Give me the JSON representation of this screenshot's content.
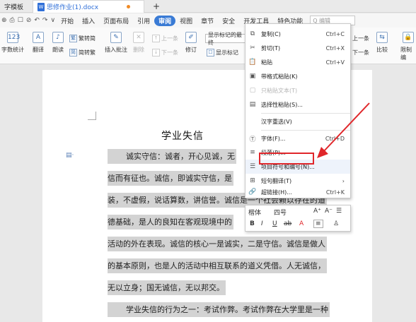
{
  "tabs": {
    "first": "字模板",
    "doc_name": "思修作业(1).docx",
    "new_tab": "+"
  },
  "menubar": {
    "quick_icons": [
      "⊕",
      "⎙",
      "☐",
      "⊘",
      "↶",
      "↷",
      "∨"
    ],
    "items": [
      "开始",
      "插入",
      "页面布局",
      "引用",
      "审阅",
      "视图",
      "章节",
      "安全",
      "开发工具",
      "特色功能"
    ],
    "active_index": 4,
    "search_placeholder": "Q 编辑"
  },
  "ribbon": {
    "word_count": "字数统计",
    "translate": "翻译",
    "read_aloud": "朗读",
    "trad_to_simp": "繁转简",
    "simp_to_trad": "简转繁",
    "insert_comment": "插入批注",
    "delete": "删除",
    "prev": "上一条",
    "next": "下一条",
    "revise": "修订",
    "show_markup_final": "显示标记的最终",
    "show_markup": "显示标记",
    "compare": "比较",
    "restrict": "限制编",
    "prev_right": "上一条",
    "next_right": "下一条"
  },
  "document": {
    "title": "学业失信",
    "lines": [
      "诚实守信：诚者，开心见诚，无",
      "信而有征也。诚信，即诚实守信，是",
      "装，不虚假，说话算数，讲信誉。诚信是一个社会赖以存在的道",
      "德基础，是人的良知在客观现境中的",
      "活动的外在表现。诚信的核心一是诚实，二是守信。诚信是做人",
      "的基本原则，也是人的活动中相互联系的道义凭借。人无诚信，",
      "无以立身；国无诚信，无以邦交。",
      "学业失信的行为之一：考试作弊。考试作弊在大学里是一种"
    ]
  },
  "context_menu": {
    "items": [
      {
        "icon": "⧉",
        "label": "复制(C)",
        "shortcut": "Ctrl+C"
      },
      {
        "icon": "✂",
        "label": "剪切(T)",
        "shortcut": "Ctrl+X"
      },
      {
        "icon": "📋",
        "label": "粘贴",
        "shortcut": "Ctrl+V"
      },
      {
        "icon": "▣",
        "label": "带格式粘贴(K)",
        "shortcut": ""
      },
      {
        "icon": "▢",
        "label": "只粘贴文本(T)",
        "shortcut": ""
      },
      {
        "icon": "▤",
        "label": "选择性粘贴(S)...",
        "shortcut": ""
      },
      {
        "icon": "",
        "label": "汉字重选(V)",
        "shortcut": ""
      },
      {
        "icon": "Ⓣ",
        "label": "字体(F)...",
        "shortcut": "Ctrl+D"
      },
      {
        "icon": "≡",
        "label": "段落(P)...",
        "shortcut": ""
      },
      {
        "icon": "☰",
        "label": "项目符号和编号(N)...",
        "shortcut": ""
      },
      {
        "icon": "⊞",
        "label": "短句翻译(T)",
        "shortcut": "›"
      },
      {
        "icon": "🔗",
        "label": "超链接(H)...",
        "shortcut": "Ctrl+K"
      }
    ]
  },
  "mini_toolbar": {
    "font": "楷体",
    "size": "四号",
    "grow": "A⁺",
    "shrink": "A⁻",
    "list": "☰",
    "bold": "B",
    "italic": "I",
    "underline": "U",
    "highlight": "ab",
    "font_color": "A",
    "align": "≡",
    "paint": "♙"
  },
  "colors": {
    "accent": "#3a7bd5",
    "highlight_border": "#e0262a",
    "arrow": "#e0262a",
    "selection": "#d3d3d3"
  }
}
